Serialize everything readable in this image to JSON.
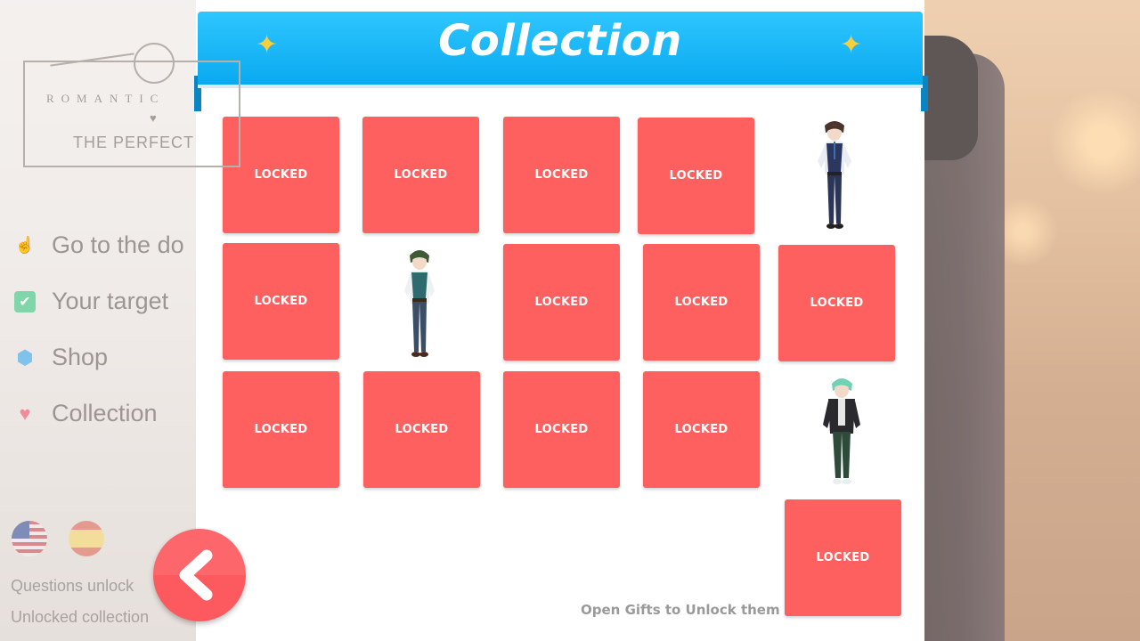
{
  "background": {
    "logo": {
      "line1": "ROMANTIC",
      "line2": "THE PERFECT"
    },
    "menu": [
      {
        "label": "Go to the do",
        "icon": "hand-icon"
      },
      {
        "label": "Your target",
        "icon": "checkbox-icon"
      },
      {
        "label": "Shop",
        "icon": "gem-icon"
      },
      {
        "label": "Collection",
        "icon": "heart-icon"
      }
    ],
    "languages": [
      "english-flag",
      "spanish-flag"
    ],
    "footer": {
      "line1": "Questions unlock",
      "line2": "Unlocked collection"
    }
  },
  "header": {
    "title": "Collection",
    "sparkle": "✦"
  },
  "grid": {
    "locked_label": "LOCKED",
    "items": [
      {
        "state": "locked"
      },
      {
        "state": "locked"
      },
      {
        "state": "locked"
      },
      {
        "state": "locked"
      },
      {
        "state": "unlocked",
        "character": "brown-haired boy in vest"
      },
      {
        "state": "locked"
      },
      {
        "state": "unlocked",
        "character": "green-haired boy in teal vest"
      },
      {
        "state": "locked"
      },
      {
        "state": "locked"
      },
      {
        "state": "locked"
      },
      {
        "state": "locked"
      },
      {
        "state": "locked"
      },
      {
        "state": "locked"
      },
      {
        "state": "locked"
      },
      {
        "state": "unlocked",
        "character": "mint-haired boy in black jacket"
      },
      {
        "state": "locked"
      }
    ]
  },
  "hint": "Open Gifts to Unlock them",
  "colors": {
    "header": "#0aa9ef",
    "locked": "#fe5f5f",
    "back": "#fd5a5f",
    "sparkle": "#f6cf3a"
  }
}
